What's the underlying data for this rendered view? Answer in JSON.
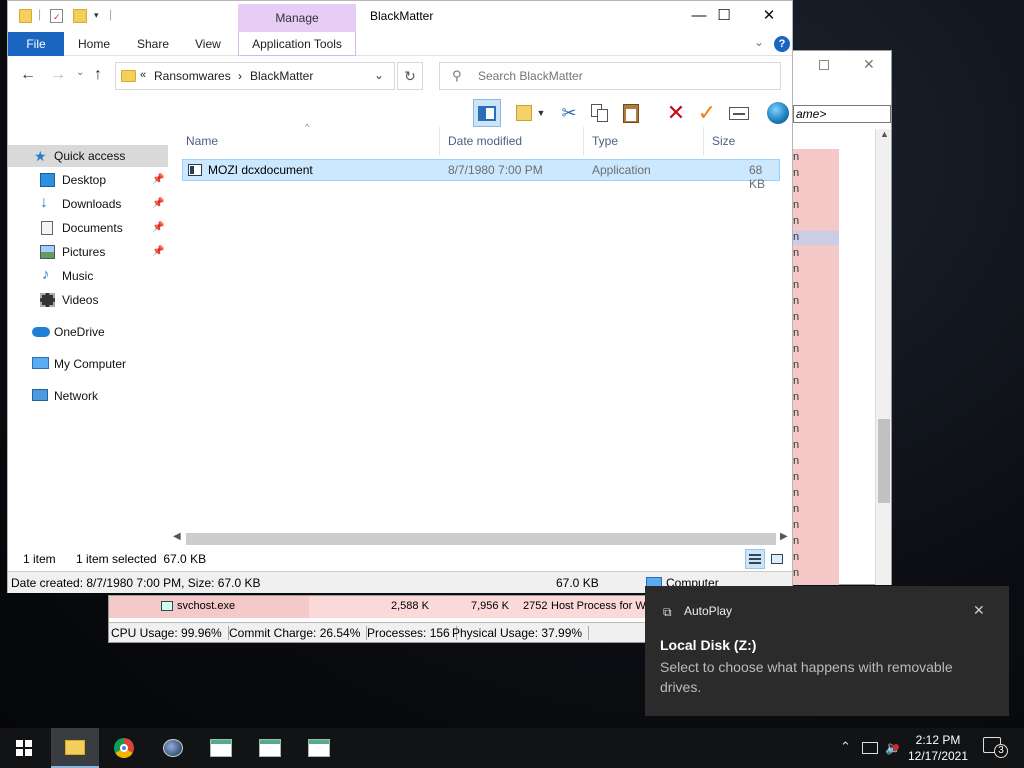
{
  "bg_window": {
    "column_header": "ame>",
    "list_letters": [
      "n",
      "n",
      "n",
      "n",
      "n",
      "n",
      "n",
      "n",
      "n",
      "n",
      "n",
      "n",
      "n",
      "n",
      "n",
      "n",
      "n",
      "n",
      "n",
      "n",
      "n",
      "n",
      "n",
      "n",
      "n",
      "n",
      "n"
    ]
  },
  "process_strip": {
    "row": {
      "name": "svchost.exe",
      "private": "2,588 K",
      "working": "7,956 K",
      "pid": "2752",
      "description": "Host Process for Wi"
    },
    "status": {
      "cpu": "CPU Usage: 99.96%",
      "commit": "Commit Charge: 26.54%",
      "processes": "Processes: 156",
      "physical": "Physical Usage: 37.99%"
    }
  },
  "explorer": {
    "title": "BlackMatter",
    "manage_label": "Manage",
    "ribbon_tabs": {
      "file": "File",
      "home": "Home",
      "share": "Share",
      "view": "View",
      "app_tools": "Application Tools"
    },
    "help": "?",
    "address": {
      "overflow": "«",
      "crumb1": "Ransomwares",
      "sep": "›",
      "crumb2": "BlackMatter"
    },
    "search_placeholder": "Search BlackMatter",
    "nav_pane": {
      "quick_access": "Quick access",
      "desktop": "Desktop",
      "downloads": "Downloads",
      "documents": "Documents",
      "pictures": "Pictures",
      "music": "Music",
      "videos": "Videos",
      "onedrive": "OneDrive",
      "my_computer": "My Computer",
      "network": "Network"
    },
    "columns": {
      "name": "Name",
      "date": "Date modified",
      "type": "Type",
      "size": "Size"
    },
    "files": [
      {
        "name": "MOZI dcxdocument",
        "date": "8/7/1980 7:00 PM",
        "type": "Application",
        "size": "68 KB"
      }
    ],
    "status": {
      "count": "1 item",
      "selected": "1 item selected  67.0 KB"
    },
    "details": {
      "created": "Date created: 8/7/1980 7:00 PM, Size: 67.0 KB",
      "size": "67.0 KB",
      "location": "Computer"
    }
  },
  "toast": {
    "app": "AutoPlay",
    "title": "Local Disk (Z:)",
    "body": "Select to choose what happens with removable drives."
  },
  "taskbar": {
    "clock_time": "2:12 PM",
    "clock_date": "12/17/2021",
    "notification_count": "3"
  },
  "colors": {
    "accent": "#1a65c0",
    "selection": "#cce8ff",
    "manage_tab": "#e7ccf6",
    "toast_bg": "#2b2b2b",
    "taskbar_bg": "#111315"
  }
}
